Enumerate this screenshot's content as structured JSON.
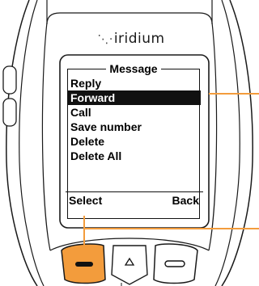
{
  "device": {
    "brand": "iridium",
    "brand_icon": "iridium-dots-logo"
  },
  "screen": {
    "title": "Message",
    "menu_items": [
      {
        "label": "Reply",
        "selected": false
      },
      {
        "label": "Forward",
        "selected": true
      },
      {
        "label": "Call",
        "selected": false
      },
      {
        "label": "Save number",
        "selected": false
      },
      {
        "label": "Delete",
        "selected": false
      },
      {
        "label": "Delete All",
        "selected": false
      }
    ],
    "softkeys": {
      "left": "Select",
      "right": "Back"
    }
  },
  "keys": {
    "left_soft_key_icon": "minus-icon",
    "nav_up_icon": "triangle-up-icon",
    "right_soft_key_icon": "dash-icon"
  },
  "colors": {
    "accent": "#f39c3c",
    "body": "#ffffff",
    "outline": "#1a1a1a",
    "highlight": "#111111"
  }
}
